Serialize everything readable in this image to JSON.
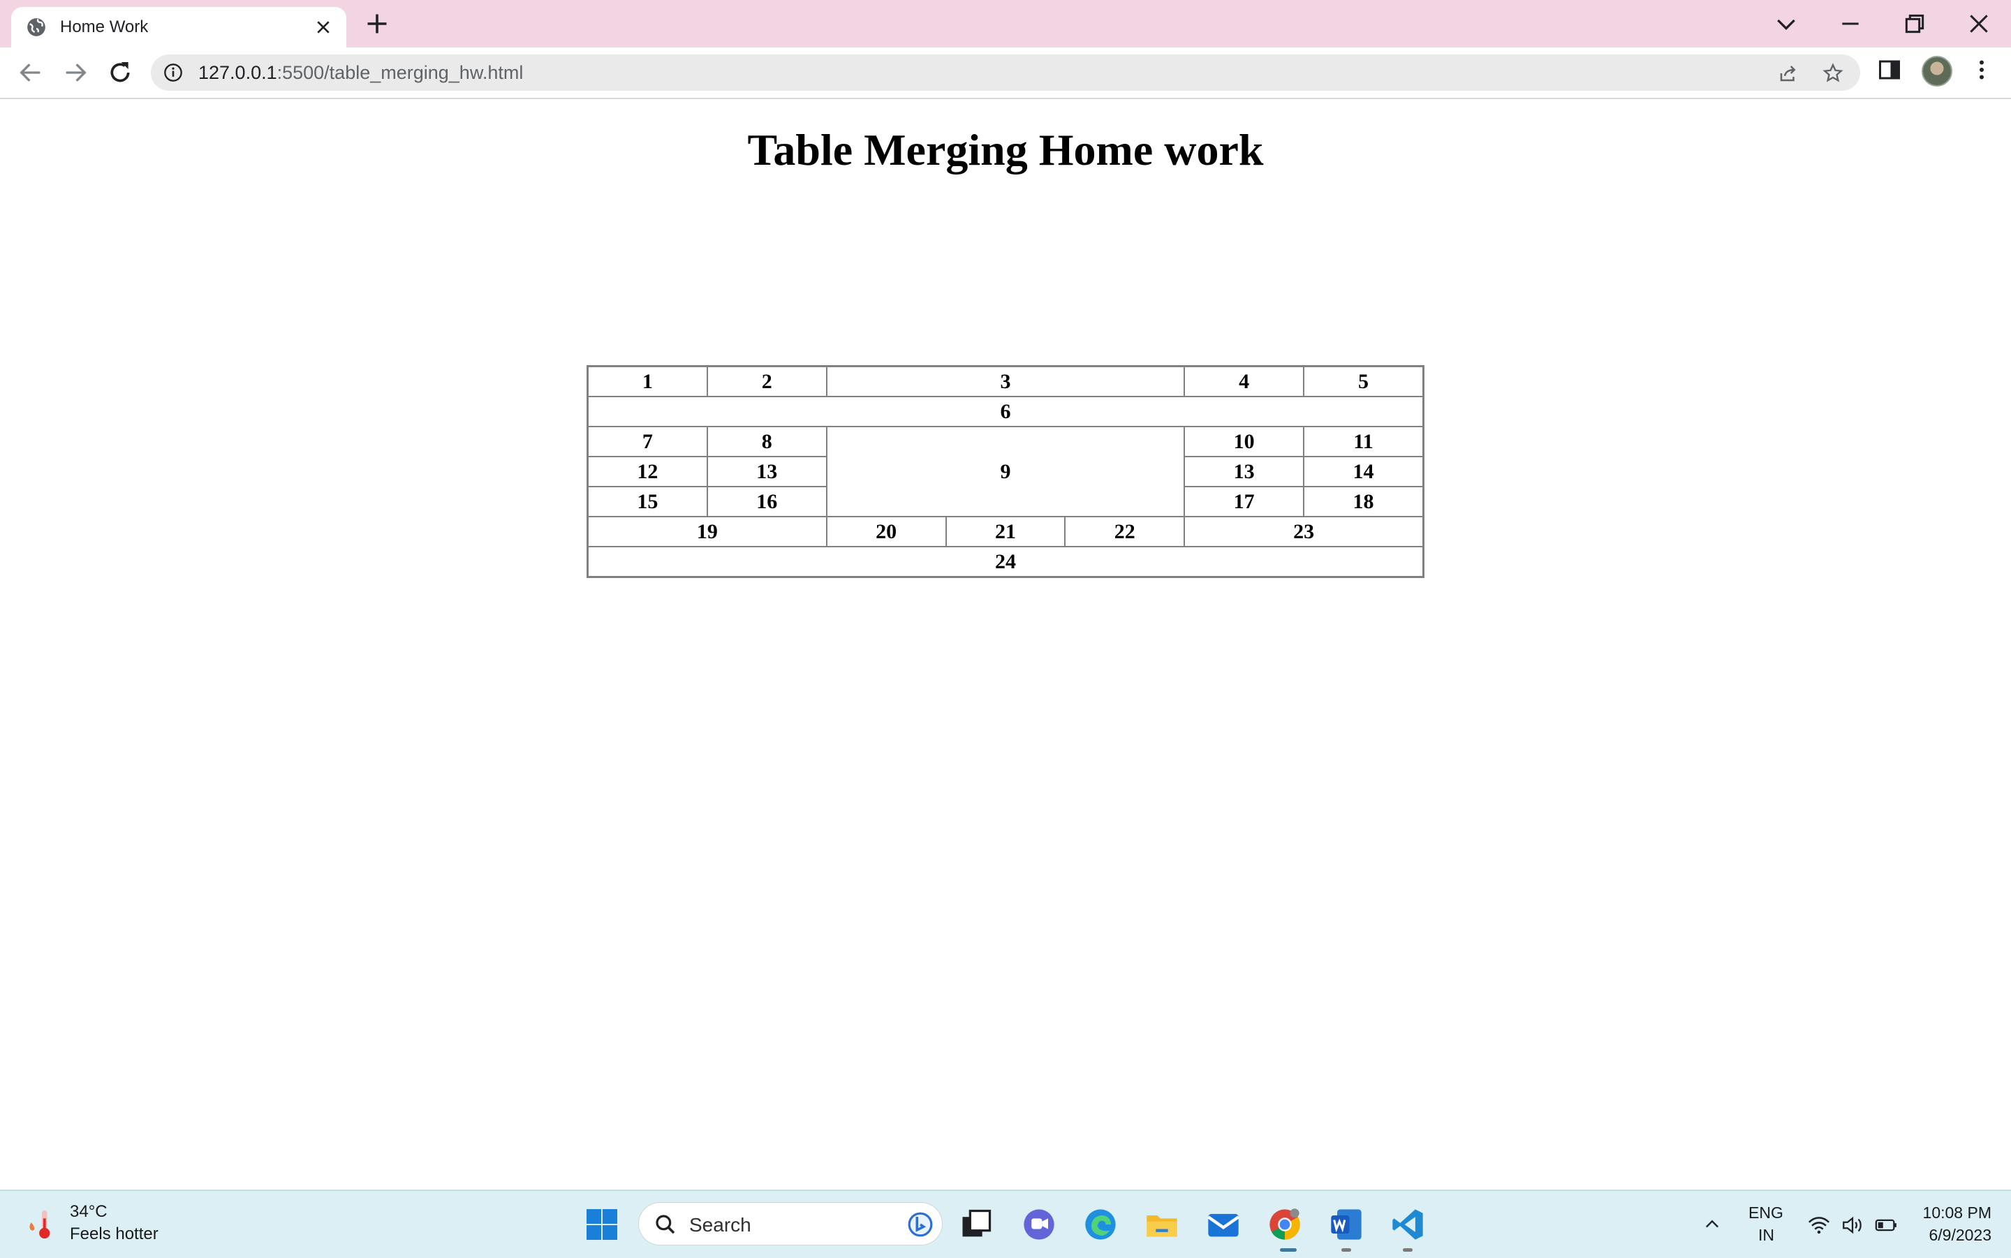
{
  "browser": {
    "tab_title": "Home Work",
    "url_host": "127.0.0.1",
    "url_rest": ":5500/table_merging_hw.html"
  },
  "page": {
    "title": "Table Merging Home work",
    "table": {
      "r1": [
        "1",
        "2",
        "3",
        "4",
        "5"
      ],
      "r2": [
        "6"
      ],
      "r3": [
        "7",
        "8",
        "9",
        "10",
        "11"
      ],
      "r4": [
        "12",
        "13",
        "13",
        "14"
      ],
      "r5": [
        "15",
        "16",
        "17",
        "18"
      ],
      "r6": [
        "19",
        "20",
        "21",
        "22",
        "23"
      ],
      "r7": [
        "24"
      ]
    }
  },
  "taskbar": {
    "weather_temp": "34°C",
    "weather_desc": "Feels hotter",
    "search_label": "Search",
    "lang_line1": "ENG",
    "lang_line2": "IN",
    "time": "10:08 PM",
    "date": "6/9/2023",
    "apps": [
      "task-view",
      "teams",
      "edge",
      "file-explorer",
      "mail",
      "chrome",
      "word",
      "vscode"
    ]
  }
}
